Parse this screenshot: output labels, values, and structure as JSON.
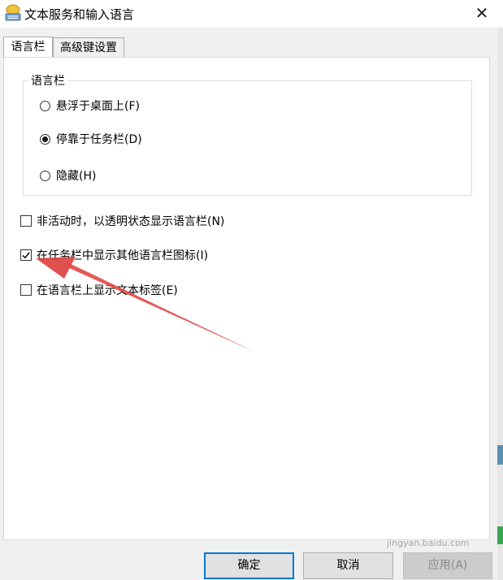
{
  "window": {
    "title": "文本服务和输入语言",
    "close_glyph": "✕"
  },
  "tabs": [
    {
      "label": "语言栏",
      "active": true
    },
    {
      "label": "高级键设置",
      "active": false
    }
  ],
  "language_bar_group": {
    "legend": "语言栏",
    "options": [
      {
        "label": "悬浮于桌面上(F)",
        "selected": false
      },
      {
        "label": "停靠于任务栏(D)",
        "selected": true
      },
      {
        "label": "隐藏(H)",
        "selected": false
      }
    ]
  },
  "checkboxes": [
    {
      "label": "非活动时，以透明状态显示语言栏(N)",
      "checked": false
    },
    {
      "label": "在任务栏中显示其他语言栏图标(I)",
      "checked": true
    },
    {
      "label": "在语言栏上显示文本标签(E)",
      "checked": false
    }
  ],
  "buttons": {
    "ok": "确定",
    "cancel": "取消",
    "apply": "应用(A)"
  },
  "watermark": "jingyan.baidu.com",
  "colors": {
    "accent": "#0078d7",
    "annotation_arrow": "#e04848"
  }
}
